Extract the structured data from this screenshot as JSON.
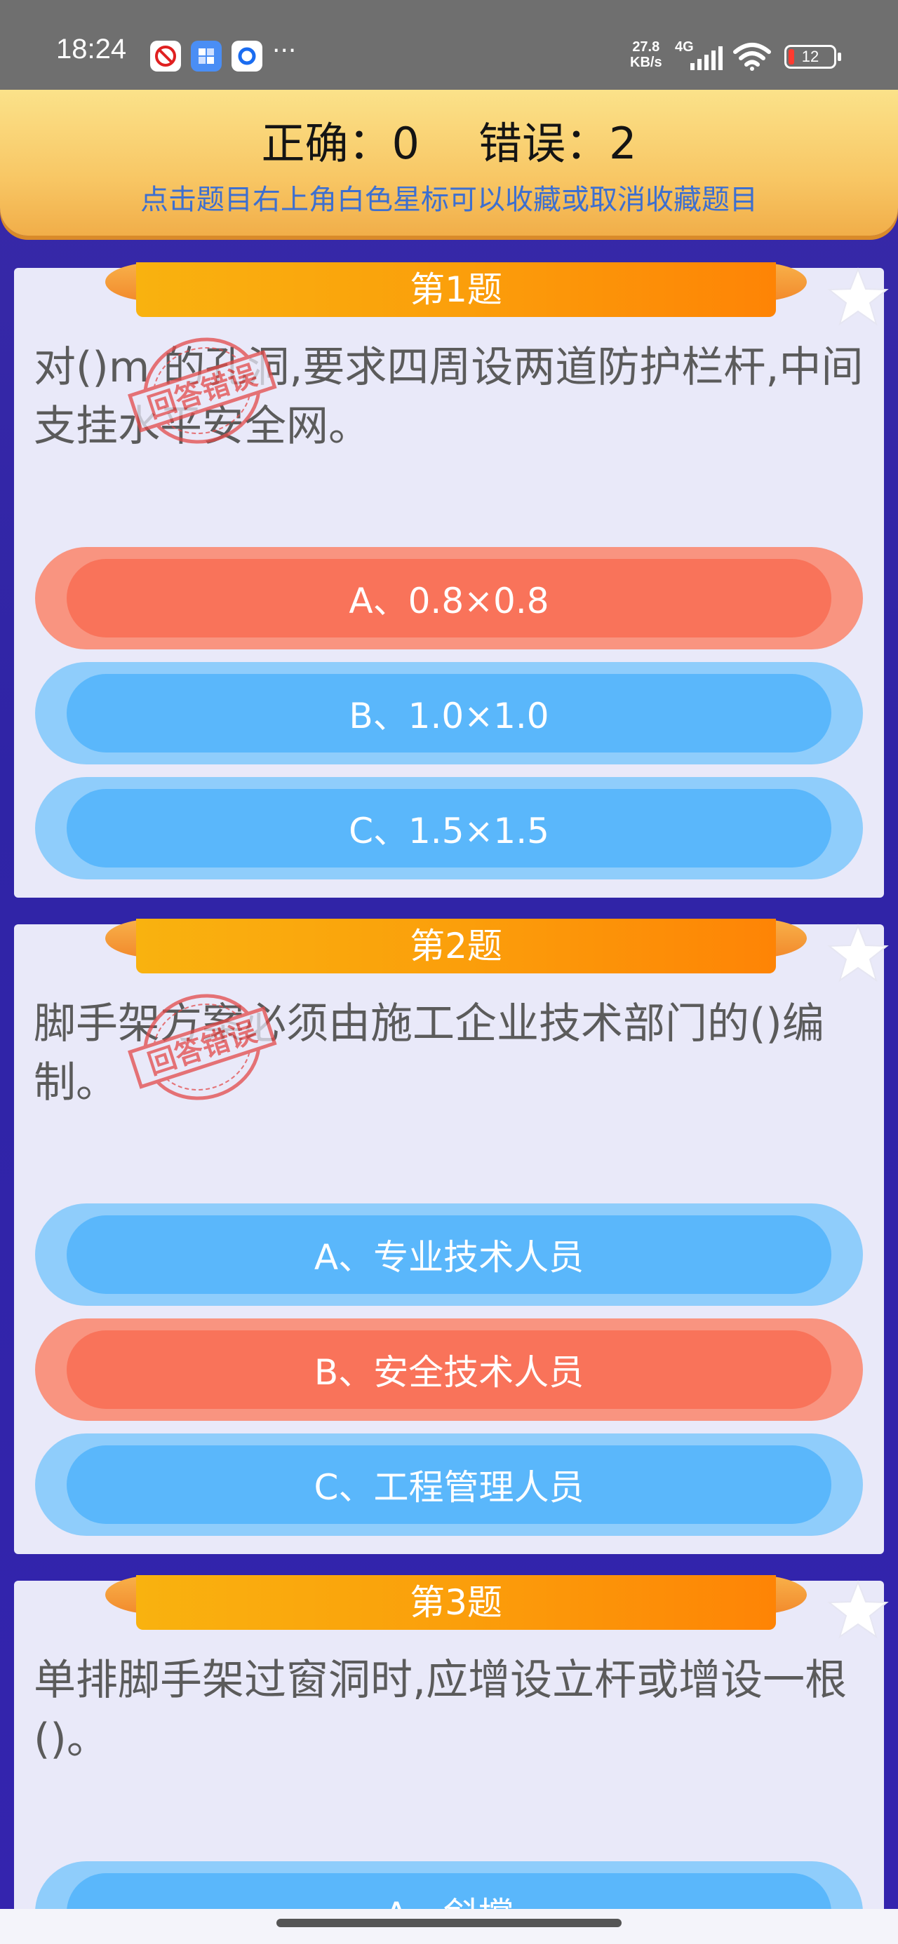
{
  "status_bar": {
    "time": "18:24",
    "overflow": "···",
    "net_speed_value": "27.8",
    "net_speed_unit": "KB/s",
    "network": "4G",
    "battery": "12"
  },
  "score": {
    "correct_label": "正确：",
    "correct_value": "0",
    "wrong_label": "错误：",
    "wrong_value": "2",
    "hint": "点击题目右上角白色星标可以收藏或取消收藏题目"
  },
  "stamp_text": "回答错误",
  "questions": [
    {
      "title": "第1题",
      "text": "对()m 的孔洞,要求四周设两道防护栏杆,中间支挂水平安全网。",
      "answered_wrong": true,
      "options": [
        {
          "label": "A、0.8×0.8",
          "state": "wrong"
        },
        {
          "label": "B、1.0×1.0",
          "state": "normal"
        },
        {
          "label": "C、1.5×1.5",
          "state": "normal"
        }
      ]
    },
    {
      "title": "第2题",
      "text": "脚手架方案必须由施工企业技术部门的()编制。",
      "answered_wrong": true,
      "options": [
        {
          "label": "A、专业技术人员",
          "state": "normal"
        },
        {
          "label": "B、安全技术人员",
          "state": "wrong"
        },
        {
          "label": "C、工程管理人员",
          "state": "normal"
        }
      ]
    },
    {
      "title": "第3题",
      "text": "单排脚手架过窗洞时,应增设立杆或增设一根()。",
      "answered_wrong": false,
      "options": [
        {
          "label": "A、斜撑",
          "state": "normal"
        }
      ]
    }
  ],
  "colors": {
    "background": "#3226a8",
    "option_blue": "#5ab7fb",
    "option_wrong": "#f9735a",
    "ribbon": "#fb9f0b",
    "header": "#f8c765"
  }
}
